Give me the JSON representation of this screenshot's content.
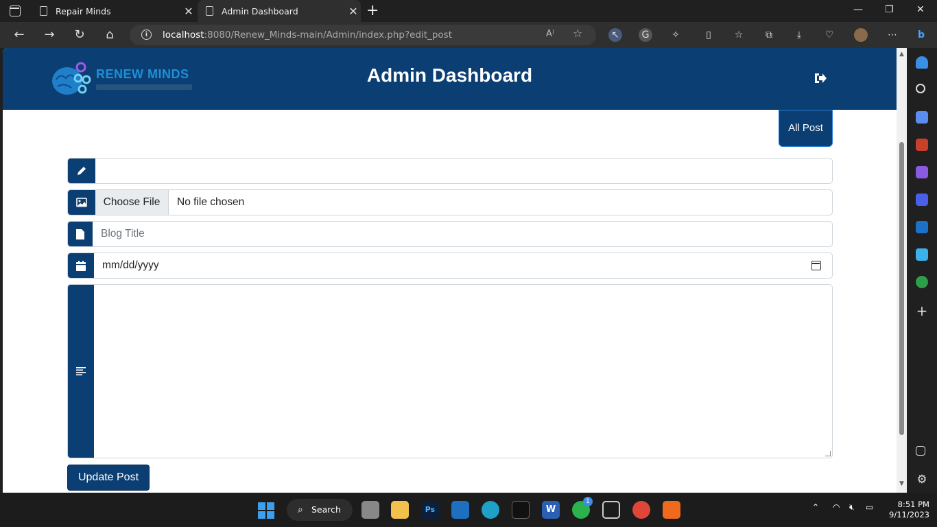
{
  "browser": {
    "tabs": [
      {
        "label": "Repair Minds"
      },
      {
        "label": "Admin Dashboard"
      }
    ],
    "url_host": "localhost",
    "url_rest": ":8080/Renew_Minds-main/Admin/index.php?edit_post",
    "read_aloud": "A⁾"
  },
  "header": {
    "logo_text": "RENEW MINDS",
    "title": "Admin Dashboard"
  },
  "actions": {
    "all_post": "All Post",
    "update_post": "Update Post"
  },
  "form": {
    "file_button": "Choose File",
    "file_status": "No file chosen",
    "blog_title_placeholder": "Blog Title",
    "date_placeholder": "mm/dd/yyyy"
  },
  "taskbar": {
    "search": "Search",
    "whatsapp_badge": "1",
    "time": "8:51 PM",
    "date": "9/11/2023"
  },
  "colors": {
    "brand": "#0b3f73",
    "logo_accent": "#1e8fd8"
  }
}
